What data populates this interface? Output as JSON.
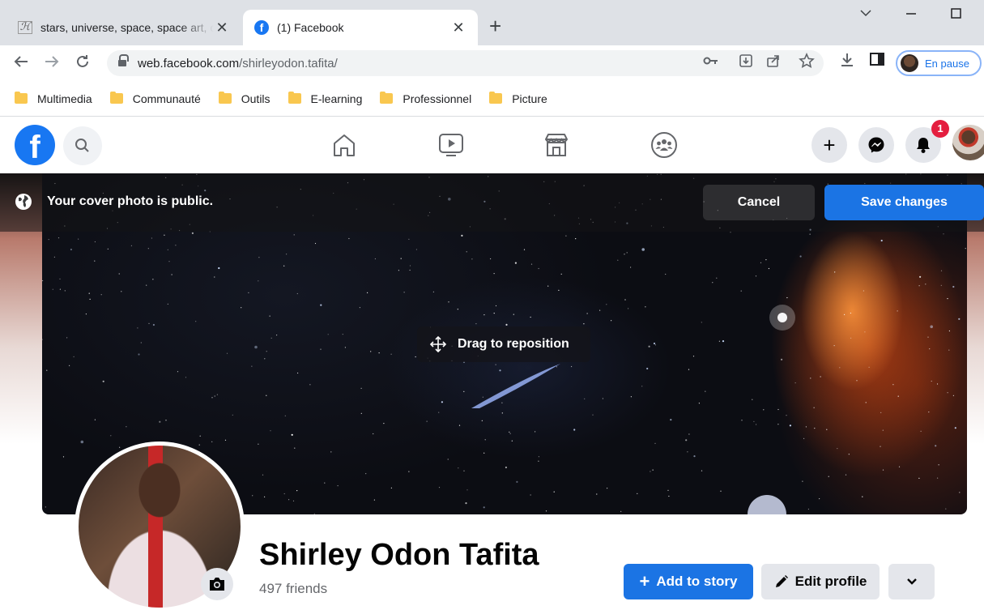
{
  "browser": {
    "tabs": [
      {
        "title": "stars, universe, space, space art, c",
        "favicon": "h-favicon-icon",
        "active": false
      },
      {
        "title": "(1) Facebook",
        "favicon": "facebook-favicon-icon",
        "active": true
      }
    ],
    "url_host": "web.facebook.com",
    "url_path": "/shirleyodon.tafita/",
    "profile_label": "En pause",
    "bookmarks": [
      "Multimedia",
      "Communauté",
      "Outils",
      "E-learning",
      "Professionnel",
      "Picture"
    ]
  },
  "fb": {
    "logo": "f",
    "notification_count": "1",
    "colors": {
      "brand": "#1877f2",
      "primary_button": "#1b74e4",
      "badge": "#e41e3f"
    }
  },
  "cover": {
    "public_message": "Your cover photo is public.",
    "cancel_label": "Cancel",
    "save_label": "Save changes",
    "drag_label": "Drag to reposition"
  },
  "profile": {
    "name": "Shirley Odon Tafita",
    "friends": "497 friends",
    "add_story_label": "Add to story",
    "edit_profile_label": "Edit profile"
  }
}
